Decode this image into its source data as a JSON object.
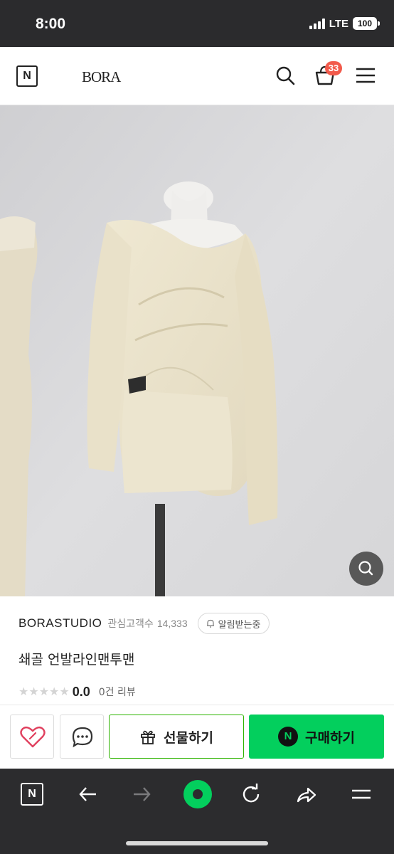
{
  "status_bar": {
    "time": "8:00",
    "network": "LTE",
    "battery": "100"
  },
  "header": {
    "home_logo": "N",
    "brand_logo": "BORA",
    "cart_count": "33",
    "icons": [
      "search-icon",
      "cart-icon",
      "hamburger-menu-icon"
    ]
  },
  "product": {
    "shop_name": "BORASTUDIO",
    "interest_label": "관심고객수",
    "interest_count": "14,333",
    "notify_label": "알림받는중",
    "title": "쇄골 언발라인맨투맨",
    "rating": "0.0",
    "rating_max_stars": 5,
    "review_count": "0건 리뷰"
  },
  "actions": {
    "wish_icon": "heart-icon",
    "talk_icon": "chat-bubble-icon",
    "gift_label": "선물하기",
    "buy_label": "구매하기",
    "buy_badge": "N"
  },
  "browser_bar": {
    "home_label": "N",
    "icons": [
      "naver-home-icon",
      "back-arrow-icon",
      "forward-arrow-icon",
      "green-dot-icon",
      "reload-icon",
      "share-icon",
      "menu-icon"
    ]
  },
  "colors": {
    "naver_green": "#03cf5d",
    "gift_border": "#2db400",
    "badge_red": "#f25a4b",
    "wish_pink": "#e0405e"
  }
}
